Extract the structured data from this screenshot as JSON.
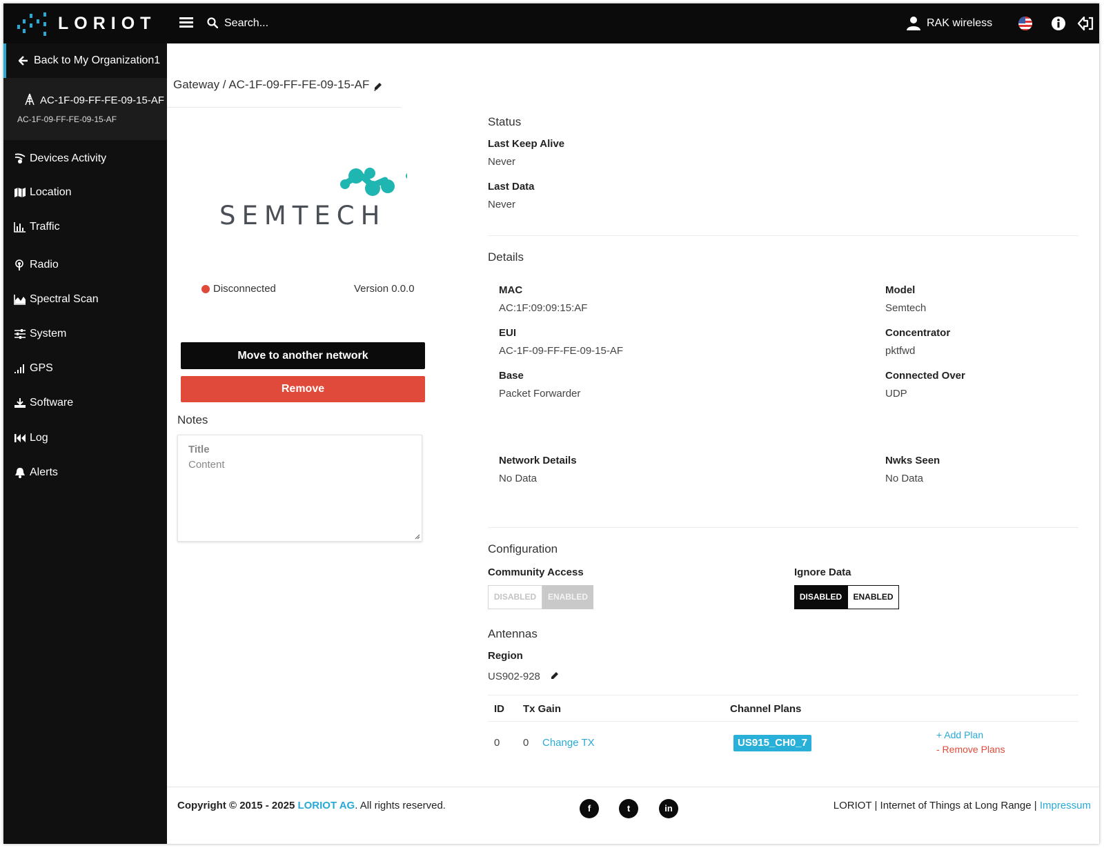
{
  "brand": {
    "logo_text": "LORIOT",
    "accent_color": "#28a9d6",
    "danger_color": "#e04a3a"
  },
  "topbar": {
    "search_placeholder": "Search...",
    "user_name": "RAK wireless",
    "icons": [
      "menu-icon",
      "search-icon",
      "user-icon",
      "flag-us-icon",
      "info-icon",
      "logout-icon"
    ]
  },
  "sidebar": {
    "back_label": "Back to My Organization1",
    "gateway_name": "AC-1F-09-FF-FE-09-15-AF",
    "gateway_sub": "AC-1F-09-FF-FE-09-15-AF",
    "items": [
      {
        "label": "Devices Activity",
        "icon": "devices-icon"
      },
      {
        "label": "Location",
        "icon": "map-icon"
      },
      {
        "label": "Traffic",
        "icon": "bar-chart-icon"
      },
      {
        "label": "Radio",
        "icon": "radio-icon"
      },
      {
        "label": "Spectral Scan",
        "icon": "area-chart-icon"
      },
      {
        "label": "System",
        "icon": "sliders-icon"
      },
      {
        "label": "GPS",
        "icon": "signal-icon"
      },
      {
        "label": "Software",
        "icon": "download-icon"
      },
      {
        "label": "Log",
        "icon": "rewind-icon"
      },
      {
        "label": "Alerts",
        "icon": "bell-icon"
      }
    ]
  },
  "gateway": {
    "breadcrumb": "Gateway / AC-1F-09-FF-FE-09-15-AF",
    "logo_text": "SEMTECH",
    "status": "Disconnected",
    "version": "Version 0.0.0",
    "move_label": "Move to another network",
    "remove_label": "Remove"
  },
  "notes": {
    "heading": "Notes",
    "title_placeholder": "Title",
    "content_placeholder": "Content"
  },
  "status_section": {
    "heading": "Status",
    "last_keep_alive_label": "Last Keep Alive",
    "last_keep_alive_value": "Never",
    "last_data_label": "Last Data",
    "last_data_value": "Never"
  },
  "details": {
    "heading": "Details",
    "mac_label": "MAC",
    "mac_value": "AC:1F:09:09:15:AF",
    "model_label": "Model",
    "model_value": "Semtech",
    "eui_label": "EUI",
    "eui_value": "AC-1F-09-FF-FE-09-15-AF",
    "concentrator_label": "Concentrator",
    "concentrator_value": "pktfwd",
    "base_label": "Base",
    "base_value": "Packet Forwarder",
    "connected_over_label": "Connected Over",
    "connected_over_value": "UDP",
    "network_details_label": "Network Details",
    "network_details_value": "No Data",
    "nwks_seen_label": "Nwks Seen",
    "nwks_seen_value": "No Data"
  },
  "configuration": {
    "heading": "Configuration",
    "community_label": "Community Access",
    "community_disabled": "DISABLED",
    "community_enabled": "ENABLED",
    "community_selected": "ENABLED",
    "ignore_label": "Ignore Data",
    "ignore_disabled": "DISABLED",
    "ignore_enabled": "ENABLED",
    "ignore_selected": "DISABLED"
  },
  "antennas": {
    "heading": "Antennas",
    "region_label": "Region",
    "region_value": "US902-928",
    "columns": [
      "ID",
      "Tx Gain",
      "Channel Plans"
    ],
    "rows": [
      {
        "id": "0",
        "tx_gain": "0",
        "change_tx": "Change TX",
        "plan": "US915_CH0_7",
        "add_plan": "+ Add Plan",
        "remove_plans": "- Remove Plans"
      }
    ]
  },
  "footer": {
    "copyright_prefix": "Copyright © 2015 - 2025 ",
    "company": "LORIOT AG",
    "rights": ". All rights reserved.",
    "social": [
      "f",
      "t",
      "in"
    ],
    "right_text": "LORIOT | Internet of Things at Long Range | ",
    "impressum": "Impressum"
  }
}
